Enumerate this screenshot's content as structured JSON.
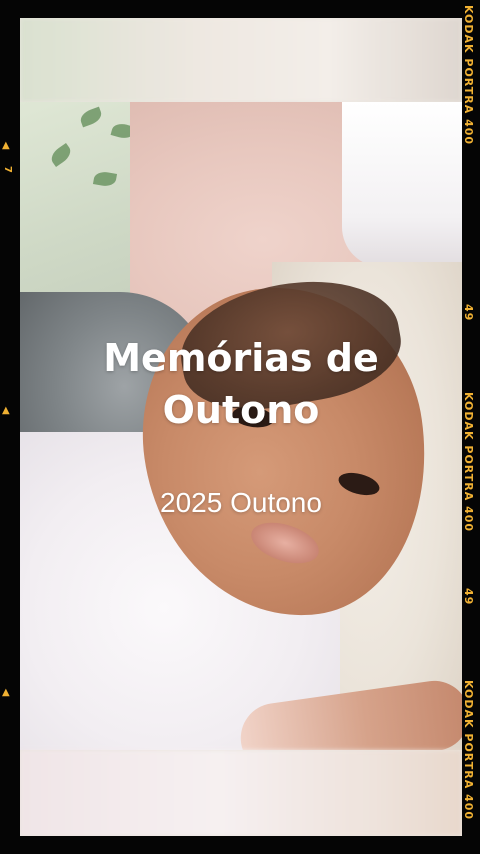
{
  "overlay": {
    "title_line1": "Memórias de",
    "title_line2": "Outono",
    "subtitle": "2025 Outono"
  },
  "film_border": {
    "side_text_1": "KODAK PORTRA 400",
    "side_text_2": "KODAK PORTRA 400",
    "side_text_3": "KODAK PORTRA 400",
    "frame_number_a": "49",
    "frame_number_b": "49",
    "left_frame_number": "7",
    "marker_icon": "triangle-marker-icon",
    "accent_color": "#f0b133"
  },
  "scene": {
    "icons": [
      "baby-photo",
      "quilt",
      "blanket"
    ]
  }
}
